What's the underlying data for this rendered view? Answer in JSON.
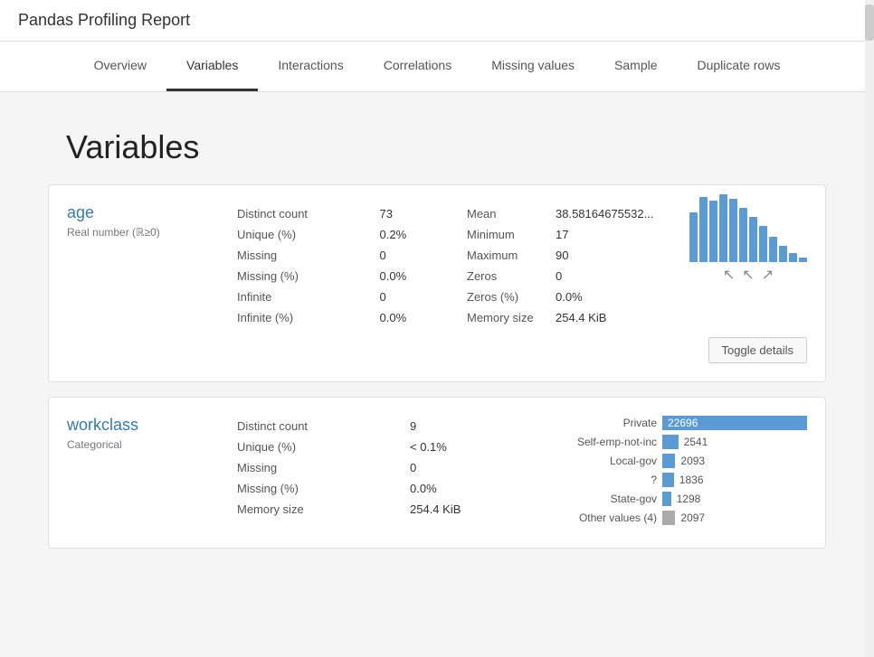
{
  "app": {
    "title": "Pandas Profiling Report"
  },
  "nav": {
    "items": [
      {
        "label": "Overview",
        "active": false
      },
      {
        "label": "Variables",
        "active": true
      },
      {
        "label": "Interactions",
        "active": false
      },
      {
        "label": "Correlations",
        "active": false
      },
      {
        "label": "Missing values",
        "active": false
      },
      {
        "label": "Sample",
        "active": false
      },
      {
        "label": "Duplicate rows",
        "active": false
      }
    ]
  },
  "page": {
    "title": "Variables"
  },
  "variables": [
    {
      "name": "age",
      "type": "Real number (ℝ≥0)",
      "stats_left": [
        {
          "label": "Distinct count",
          "value": "73"
        },
        {
          "label": "Unique (%)",
          "value": "0.2%"
        },
        {
          "label": "Missing",
          "value": "0"
        },
        {
          "label": "Missing (%)",
          "value": "0.0%"
        },
        {
          "label": "Infinite",
          "value": "0"
        },
        {
          "label": "Infinite (%)",
          "value": "0.0%"
        }
      ],
      "stats_right": [
        {
          "label": "Mean",
          "value": "38.5816467553..."
        },
        {
          "label": "Minimum",
          "value": "17"
        },
        {
          "label": "Maximum",
          "value": "90"
        },
        {
          "label": "Zeros",
          "value": "0"
        },
        {
          "label": "Zeros (%)",
          "value": "0.0%"
        },
        {
          "label": "Memory size",
          "value": "254.4 KiB"
        }
      ],
      "histogram_bars": [
        55,
        72,
        68,
        75,
        70,
        60,
        50,
        40,
        30,
        18,
        10,
        5
      ],
      "toggle_label": "Toggle details"
    },
    {
      "name": "workclass",
      "type": "Categorical",
      "stats_left": [
        {
          "label": "Distinct count",
          "value": "9"
        },
        {
          "label": "Unique (%)",
          "value": "< 0.1%"
        },
        {
          "label": "Missing",
          "value": "0"
        },
        {
          "label": "Missing (%)",
          "value": "0.0%"
        },
        {
          "label": "Memory size",
          "value": "254.4 KiB"
        }
      ],
      "cat_values": [
        {
          "label": "Private",
          "count": "22696",
          "width": 100,
          "other": false
        },
        {
          "label": "Self-emp-not-inc",
          "count": "2541",
          "width": 11,
          "other": false
        },
        {
          "label": "Local-gov",
          "count": "2093",
          "width": 9,
          "other": false
        },
        {
          "label": "?",
          "count": "1836",
          "width": 8,
          "other": false
        },
        {
          "label": "State-gov",
          "count": "1298",
          "width": 6,
          "other": false
        },
        {
          "label": "Other values (4)",
          "count": "2097",
          "width": 9,
          "other": true
        }
      ]
    }
  ]
}
